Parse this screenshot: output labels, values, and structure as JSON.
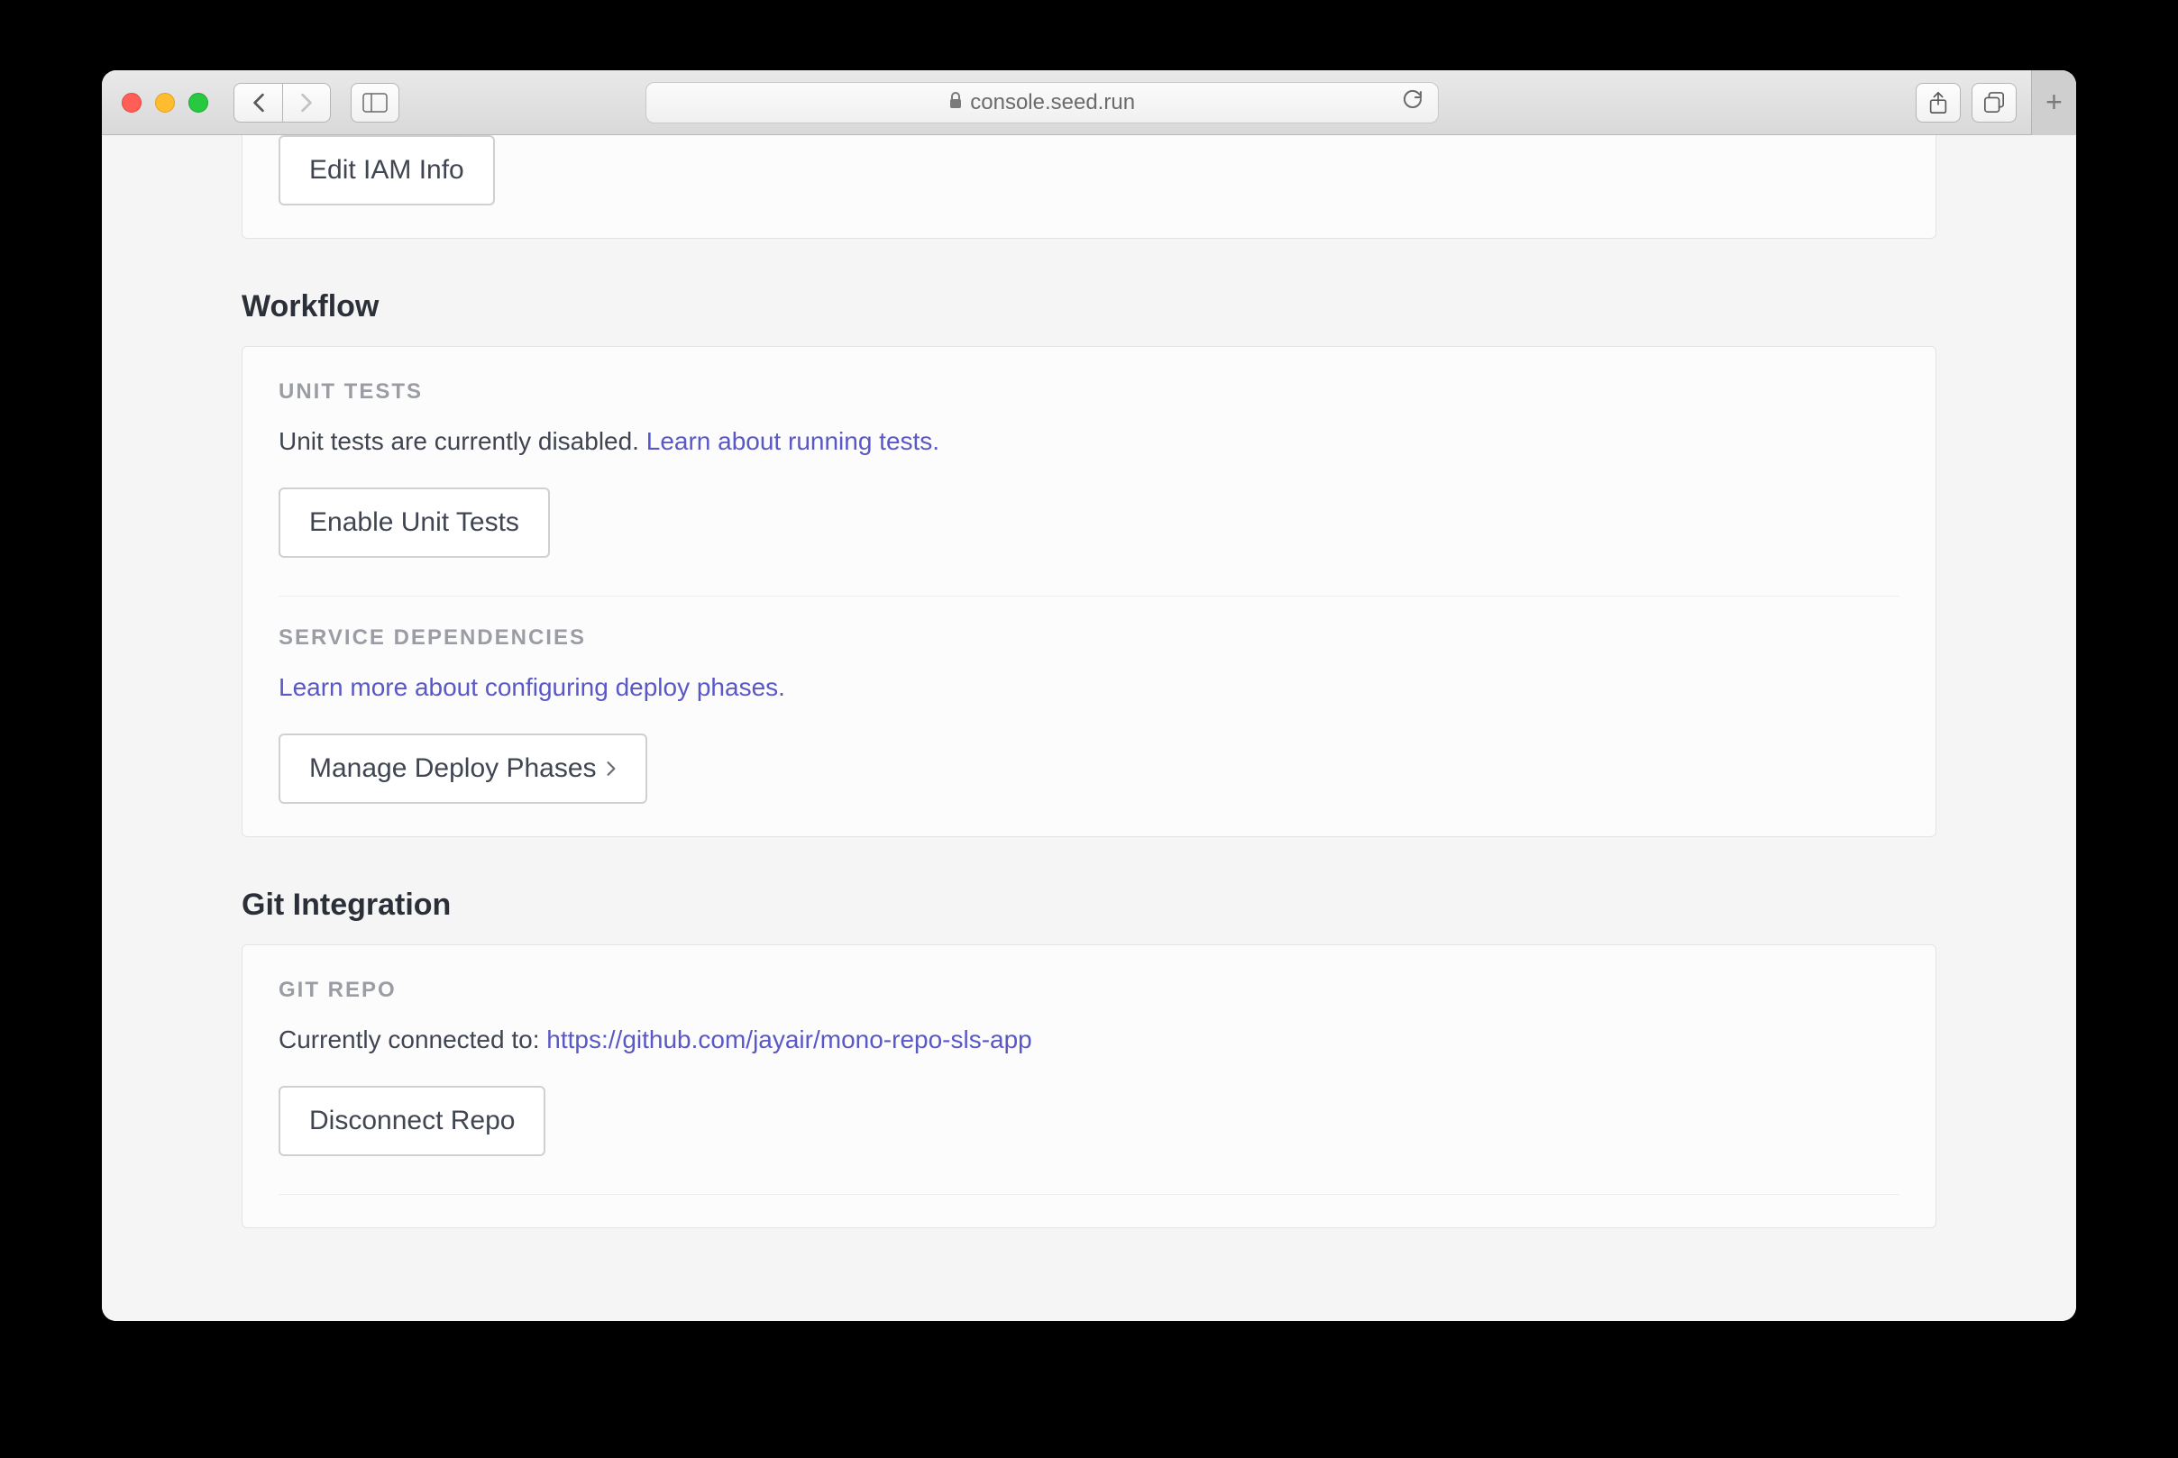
{
  "browser": {
    "url": "console.seed.run"
  },
  "iam": {
    "button": "Edit IAM Info"
  },
  "workflow": {
    "title": "Workflow",
    "unit_tests": {
      "label": "UNIT TESTS",
      "text": "Unit tests are currently disabled. ",
      "link": "Learn about running tests.",
      "button": "Enable Unit Tests"
    },
    "service_deps": {
      "label": "SERVICE DEPENDENCIES",
      "link": "Learn more about configuring deploy phases.",
      "button": "Manage Deploy Phases"
    }
  },
  "git": {
    "title": "Git Integration",
    "repo": {
      "label": "GIT REPO",
      "text": "Currently connected to: ",
      "link": "https://github.com/jayair/mono-repo-sls-app",
      "button": "Disconnect Repo"
    }
  }
}
